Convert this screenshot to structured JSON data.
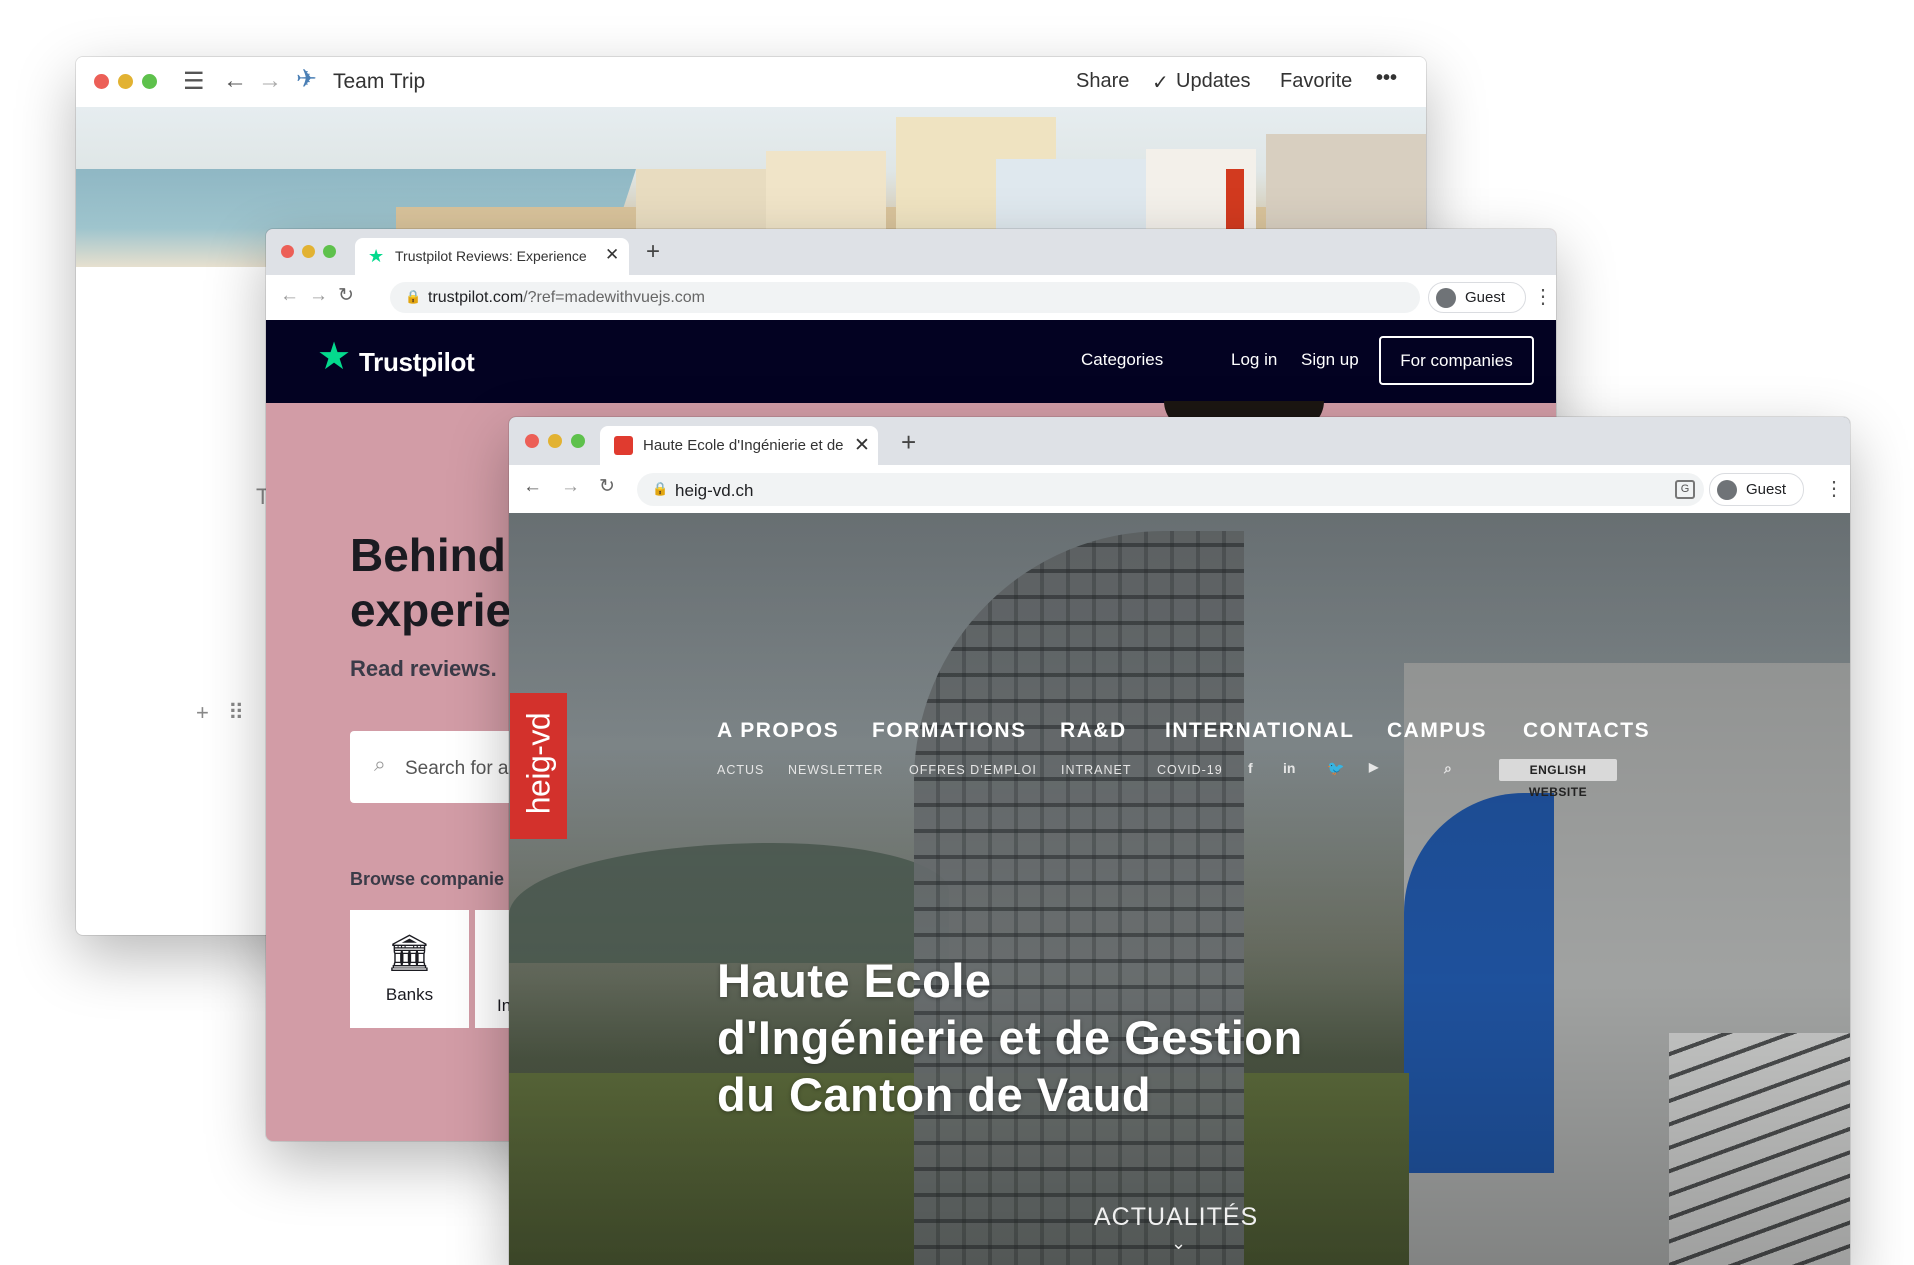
{
  "notion_window": {
    "title": "Team Trip",
    "actions": {
      "share": "Share",
      "updates": "Updates",
      "favorite": "Favorite",
      "more": "•••"
    },
    "side_marks": {
      "t": "T",
      "add": "+",
      "drag": "⠿"
    },
    "icons": [
      "menu-icon",
      "back-icon",
      "forward-icon",
      "airplane-icon"
    ]
  },
  "trustpilot_window": {
    "tab_title": "Trustpilot Reviews: Experience",
    "url_host": "trustpilot.com",
    "url_rest": "/?ref=madewithvuejs.com",
    "profile": "Guest",
    "header": {
      "logo": "Trustpilot",
      "nav": [
        "Categories",
        "Log in",
        "Sign up"
      ],
      "cta": "For companies"
    },
    "hero": {
      "line1": "Behind",
      "line2": "experie",
      "subtitle": "Read reviews.",
      "search_placeholder": "Search for a",
      "browse_label": "Browse companie"
    },
    "cards": [
      {
        "label": "Banks",
        "icon": "bank-icon"
      },
      {
        "label": "In",
        "icon": "insurance-icon"
      }
    ],
    "colors": {
      "header_bg": "#030222",
      "hero_bg": "#d29ca6",
      "star": "#04da8d"
    }
  },
  "heig_window": {
    "tab_title": "Haute Ecole d'Ingénierie et de",
    "url": "heig-vd.ch",
    "profile": "Guest",
    "logo": "heig-vd",
    "main_nav": [
      "A PROPOS",
      "FORMATIONS",
      "RA&D",
      "INTERNATIONAL",
      "CAMPUS",
      "CONTACTS"
    ],
    "sub_nav": [
      "ACTUS",
      "NEWSLETTER",
      "OFFRES D'EMPLOI",
      "INTRANET",
      "COVID-19"
    ],
    "social": [
      {
        "glyph": "f",
        "icon": "facebook-icon"
      },
      {
        "glyph": "in",
        "icon": "linkedin-icon"
      },
      {
        "glyph": "🐦",
        "icon": "twitter-icon"
      },
      {
        "glyph": "▶",
        "icon": "youtube-icon"
      }
    ],
    "english": "ENGLISH WEBSITE",
    "title_lines": [
      "Haute Ecole",
      "d'Ingénierie et de Gestion",
      "du Canton de Vaud"
    ],
    "news": "ACTUALITÉS",
    "colors": {
      "logo_red": "#d3312c"
    }
  }
}
